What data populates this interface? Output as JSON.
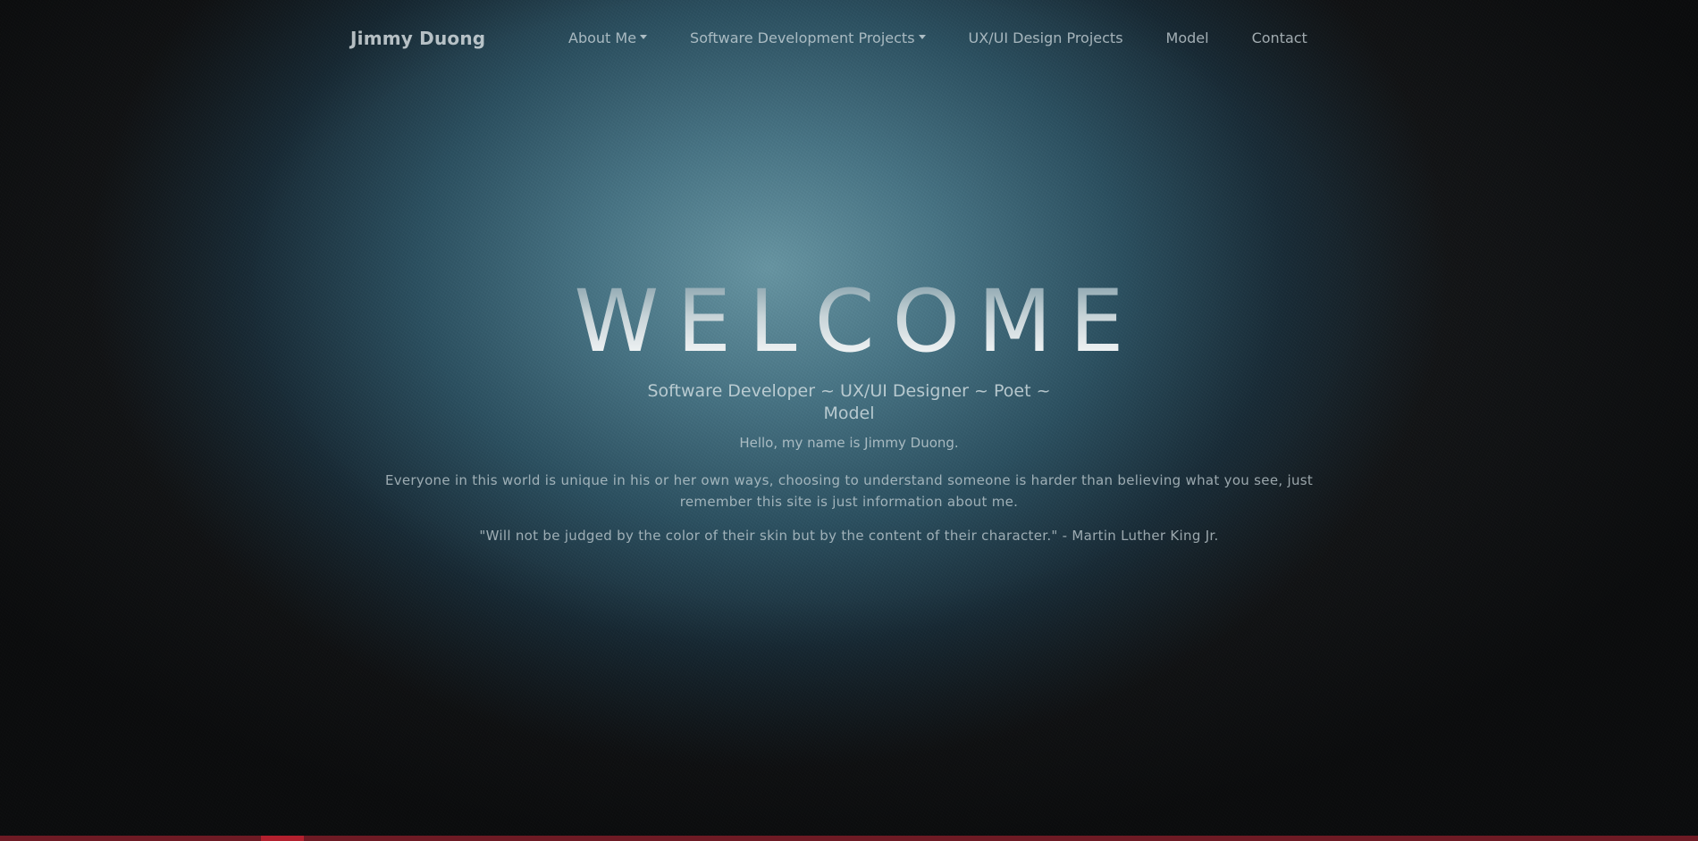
{
  "navbar": {
    "brand": "Jimmy Duong",
    "items": [
      {
        "label": "About Me",
        "dropdown": true
      },
      {
        "label": "Software Development Projects",
        "dropdown": true
      },
      {
        "label": "UX/UI Design Projects",
        "dropdown": false
      },
      {
        "label": "Model",
        "dropdown": false
      },
      {
        "label": "Contact",
        "dropdown": false
      }
    ]
  },
  "hero": {
    "heading": "WELCOME",
    "subtitle": "Software Developer ~ UX/UI Designer ~ Poet ~ Model",
    "greeting": "Hello, my name is Jimmy Duong.",
    "intro": "Everyone in this world is unique in his or her own ways, choosing to understand someone is harder than believing what you see, just remember this site is just information about me.",
    "quote": "\"Will not be judged by the color of their skin but by the content of their character.\" - Martin Luther King Jr."
  },
  "colors": {
    "background_dark": "#151617",
    "background_teal": "#6c9caa",
    "bottom_bar": "#6e1a24",
    "bottom_bar_accent": "#b3202e"
  },
  "icons": {
    "dropdown_caret": "caret-down-icon"
  }
}
